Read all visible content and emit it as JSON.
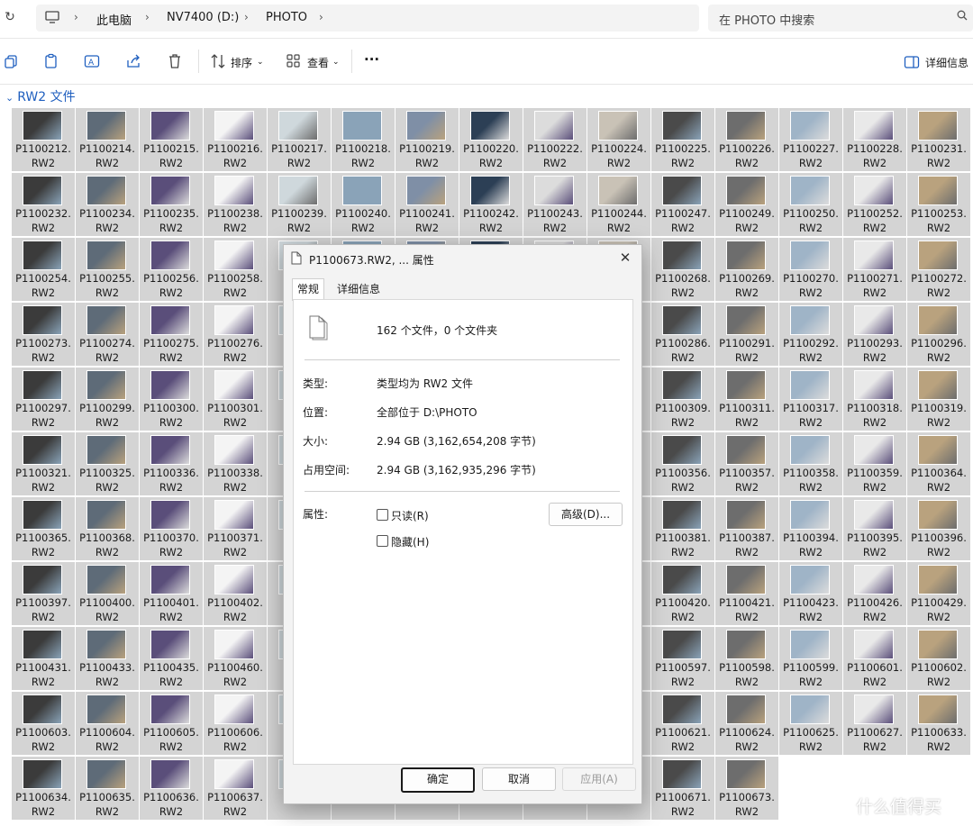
{
  "address": {
    "breadcrumbs": [
      "此电脑",
      "NV7400 (D:)",
      "PHOTO"
    ],
    "search_placeholder": "在 PHOTO 中搜索"
  },
  "toolbar": {
    "sort_label": "排序",
    "view_label": "查看",
    "more_label": "···",
    "details_label": "详细信息"
  },
  "group": {
    "title": "RW2 文件"
  },
  "file_ext": "RW2",
  "files": [
    "P1100212.",
    "P1100214.",
    "P1100215.",
    "P1100216.",
    "P1100217.",
    "P1100218.",
    "P1100219.",
    "P1100220.",
    "P1100222.",
    "P1100224.",
    "P1100225.",
    "P1100226.",
    "P1100227.",
    "P1100228.",
    "P1100231.",
    "P1100232.",
    "P1100234.",
    "P1100235.",
    "P1100238.",
    "P1100239.",
    "P1100240.",
    "P1100241.",
    "P1100242.",
    "P1100243.",
    "P1100244.",
    "P1100247.",
    "P1100249.",
    "P1100250.",
    "P1100252.",
    "P1100253.",
    "P1100254.",
    "P1100255.",
    "P1100256.",
    "P1100258.",
    "",
    "",
    "",
    "",
    "",
    "",
    "P1100268.",
    "P1100269.",
    "P1100270.",
    "P1100271.",
    "P1100272.",
    "P1100273.",
    "P1100274.",
    "P1100275.",
    "P1100276.",
    "",
    "",
    "",
    "",
    "",
    "",
    "P1100286.",
    "P1100291.",
    "P1100292.",
    "P1100293.",
    "P1100296.",
    "P1100297.",
    "P1100299.",
    "P1100300.",
    "P1100301.",
    "",
    "",
    "",
    "",
    "",
    "",
    "P1100309.",
    "P1100311.",
    "P1100317.",
    "P1100318.",
    "P1100319.",
    "P1100321.",
    "P1100325.",
    "P1100336.",
    "P1100338.",
    "",
    "",
    "",
    "",
    "",
    "",
    "P1100356.",
    "P1100357.",
    "P1100358.",
    "P1100359.",
    "P1100364.",
    "P1100365.",
    "P1100368.",
    "P1100370.",
    "P1100371.",
    "",
    "",
    "",
    "",
    "",
    "",
    "P1100381.",
    "P1100387.",
    "P1100394.",
    "P1100395.",
    "P1100396.",
    "P1100397.",
    "P1100400.",
    "P1100401.",
    "P1100402.",
    "",
    "",
    "",
    "",
    "",
    "",
    "P1100420.",
    "P1100421.",
    "P1100423.",
    "P1100426.",
    "P1100429.",
    "P1100431.",
    "P1100433.",
    "P1100435.",
    "P1100460.",
    "",
    "",
    "",
    "",
    "",
    "",
    "P1100597.",
    "P1100598.",
    "P1100599.",
    "P1100601.",
    "P1100602.",
    "P1100603.",
    "P1100604.",
    "P1100605.",
    "P1100606.",
    "",
    "",
    "",
    "",
    "",
    "",
    "P1100621.",
    "P1100624.",
    "P1100625.",
    "P1100627.",
    "P1100633.",
    "P1100634.",
    "P1100635.",
    "P1100636.",
    "P1100637.",
    "",
    "",
    "",
    "",
    "",
    "",
    "P1100671.",
    "P1100673."
  ],
  "dialog": {
    "title": "P1100673.RW2, ... 属性",
    "tabs": [
      "常规",
      "详细信息"
    ],
    "summary": "162 个文件，0 个文件夹",
    "rows": [
      {
        "label": "类型:",
        "value": "类型均为 RW2 文件"
      },
      {
        "label": "位置:",
        "value": "全部位于 D:\\PHOTO"
      },
      {
        "label": "大小:",
        "value": "2.94 GB (3,162,654,208 字节)"
      },
      {
        "label": "占用空间:",
        "value": "2.94 GB (3,162,935,296 字节)"
      }
    ],
    "attributes_label": "属性:",
    "readonly_label": "只读(R)",
    "hidden_label": "隐藏(H)",
    "advanced_button": "高级(D)...",
    "ok_button": "确定",
    "cancel_button": "取消",
    "apply_button": "应用(A)"
  },
  "watermark": {
    "text": "什么值得买"
  },
  "colors": {
    "accent": "#1f5fbf",
    "selection": "#d4d4d4",
    "dialog_bg": "#f3f3f3"
  }
}
